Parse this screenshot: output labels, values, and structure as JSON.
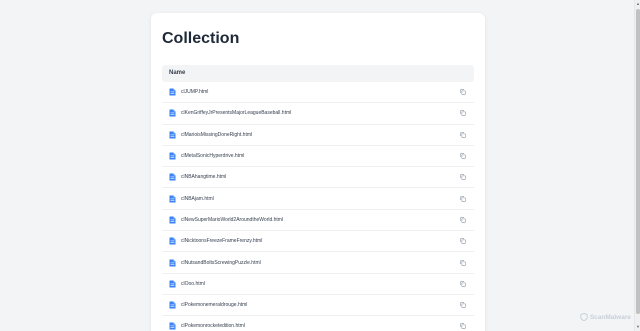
{
  "page": {
    "title": "Collection"
  },
  "table": {
    "header_name": "Name",
    "files": [
      "clJUMP.html",
      "clKenGriffeyJrPresentsMajorLeagueBaseball.html",
      "clMarioisMissingDoneRight.html",
      "clMetalSonicHyperdrive.html",
      "clNBAhangtime.html",
      "clNBAjam.html",
      "clNewSuperMarioWorld2AroundtheWorld.html",
      "clNicktoonsFreezeFrameFrenzy.html",
      "clNutsandBoltsScrewingPuzzle.html",
      "clOoo.html",
      "clPokemonemeraldrouge.html",
      "clPokemonrocketedition.html"
    ]
  },
  "icons": {
    "file": "file-document-icon",
    "copy": "copy-icon"
  },
  "watermark": {
    "text": "ScanMalware"
  },
  "colors": {
    "file_icon": "#3b82f6",
    "copy_icon": "#9ca3af",
    "background": "#f3f4f6",
    "card": "#ffffff"
  }
}
